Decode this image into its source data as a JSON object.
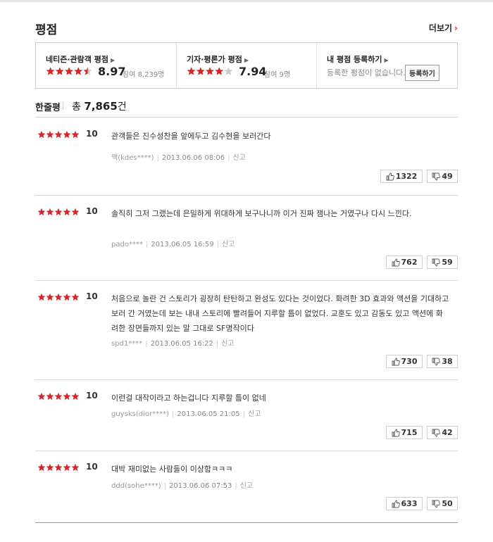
{
  "header": {
    "title": "평점",
    "more_label": "더보기"
  },
  "ratings": {
    "audience": {
      "label": "네티즌·관람객 평점",
      "score": "8.97",
      "participants": "참여 8,239명",
      "stars": 4.5
    },
    "critic": {
      "label": "기자·평론가 평점",
      "score": "7.94",
      "participants": "참여 9명",
      "stars": 4
    },
    "mine": {
      "label": "내 평점 등록하기",
      "message": "등록한 평점이 없습니다.",
      "button_label": "등록하기"
    }
  },
  "reviews_header": {
    "label": "한줄평",
    "total_prefix": "총 ",
    "total_count": "7,865",
    "total_suffix": "건"
  },
  "reviews": [
    {
      "score": "10",
      "text": "관객들은 진수성찬을 앞에두고 김수현을 보러간다",
      "user": "맥(kdes****)",
      "date": "2013.06.06 08:06",
      "report": "신고",
      "likes": "1322",
      "dislikes": "49"
    },
    {
      "score": "10",
      "text": "솔직히 그저 그랬는데 은밀하게 위대하게 보구나니까 이거 진짜 잼나는 거였구나 다시 느낀다.",
      "user": "pado****",
      "date": "2013.06.05 16:59",
      "report": "신고",
      "likes": "762",
      "dislikes": "59"
    },
    {
      "score": "10",
      "text": "처음으로 놀란 건 스토리가 굉장히 탄탄하고 완성도 있다는 것이었다. 화려한 3D 효과와 액션을 기대하고 보러 간 거였는데 보는 내내 스토리에 빨려들어 지루할 틈이 없었다. 교훈도 있고 감동도 있고 액션에 화려한 장면들까지 있는 말 그대로 SF명작이다",
      "user": "spd1****",
      "date": "2013.06.05 16:22",
      "report": "신고",
      "likes": "730",
      "dislikes": "38"
    },
    {
      "score": "10",
      "text": "이런걸 대작이라고 하는겁니다 지루할 틈이 없네",
      "user": "guysks(dior****)",
      "date": "2013.06.05 21:05",
      "report": "신고",
      "likes": "715",
      "dislikes": "42"
    },
    {
      "score": "10",
      "text": "대박 재미없는 사람들이 이상함ㅋㅋㅋ",
      "user": "ddd(sohe****)",
      "date": "2013.06.06 07:53",
      "report": "신고",
      "likes": "633",
      "dislikes": "50"
    }
  ],
  "colors": {
    "star_on": "#d3272b",
    "star_off": "#c8c8c8",
    "accent": "#d3272b"
  }
}
